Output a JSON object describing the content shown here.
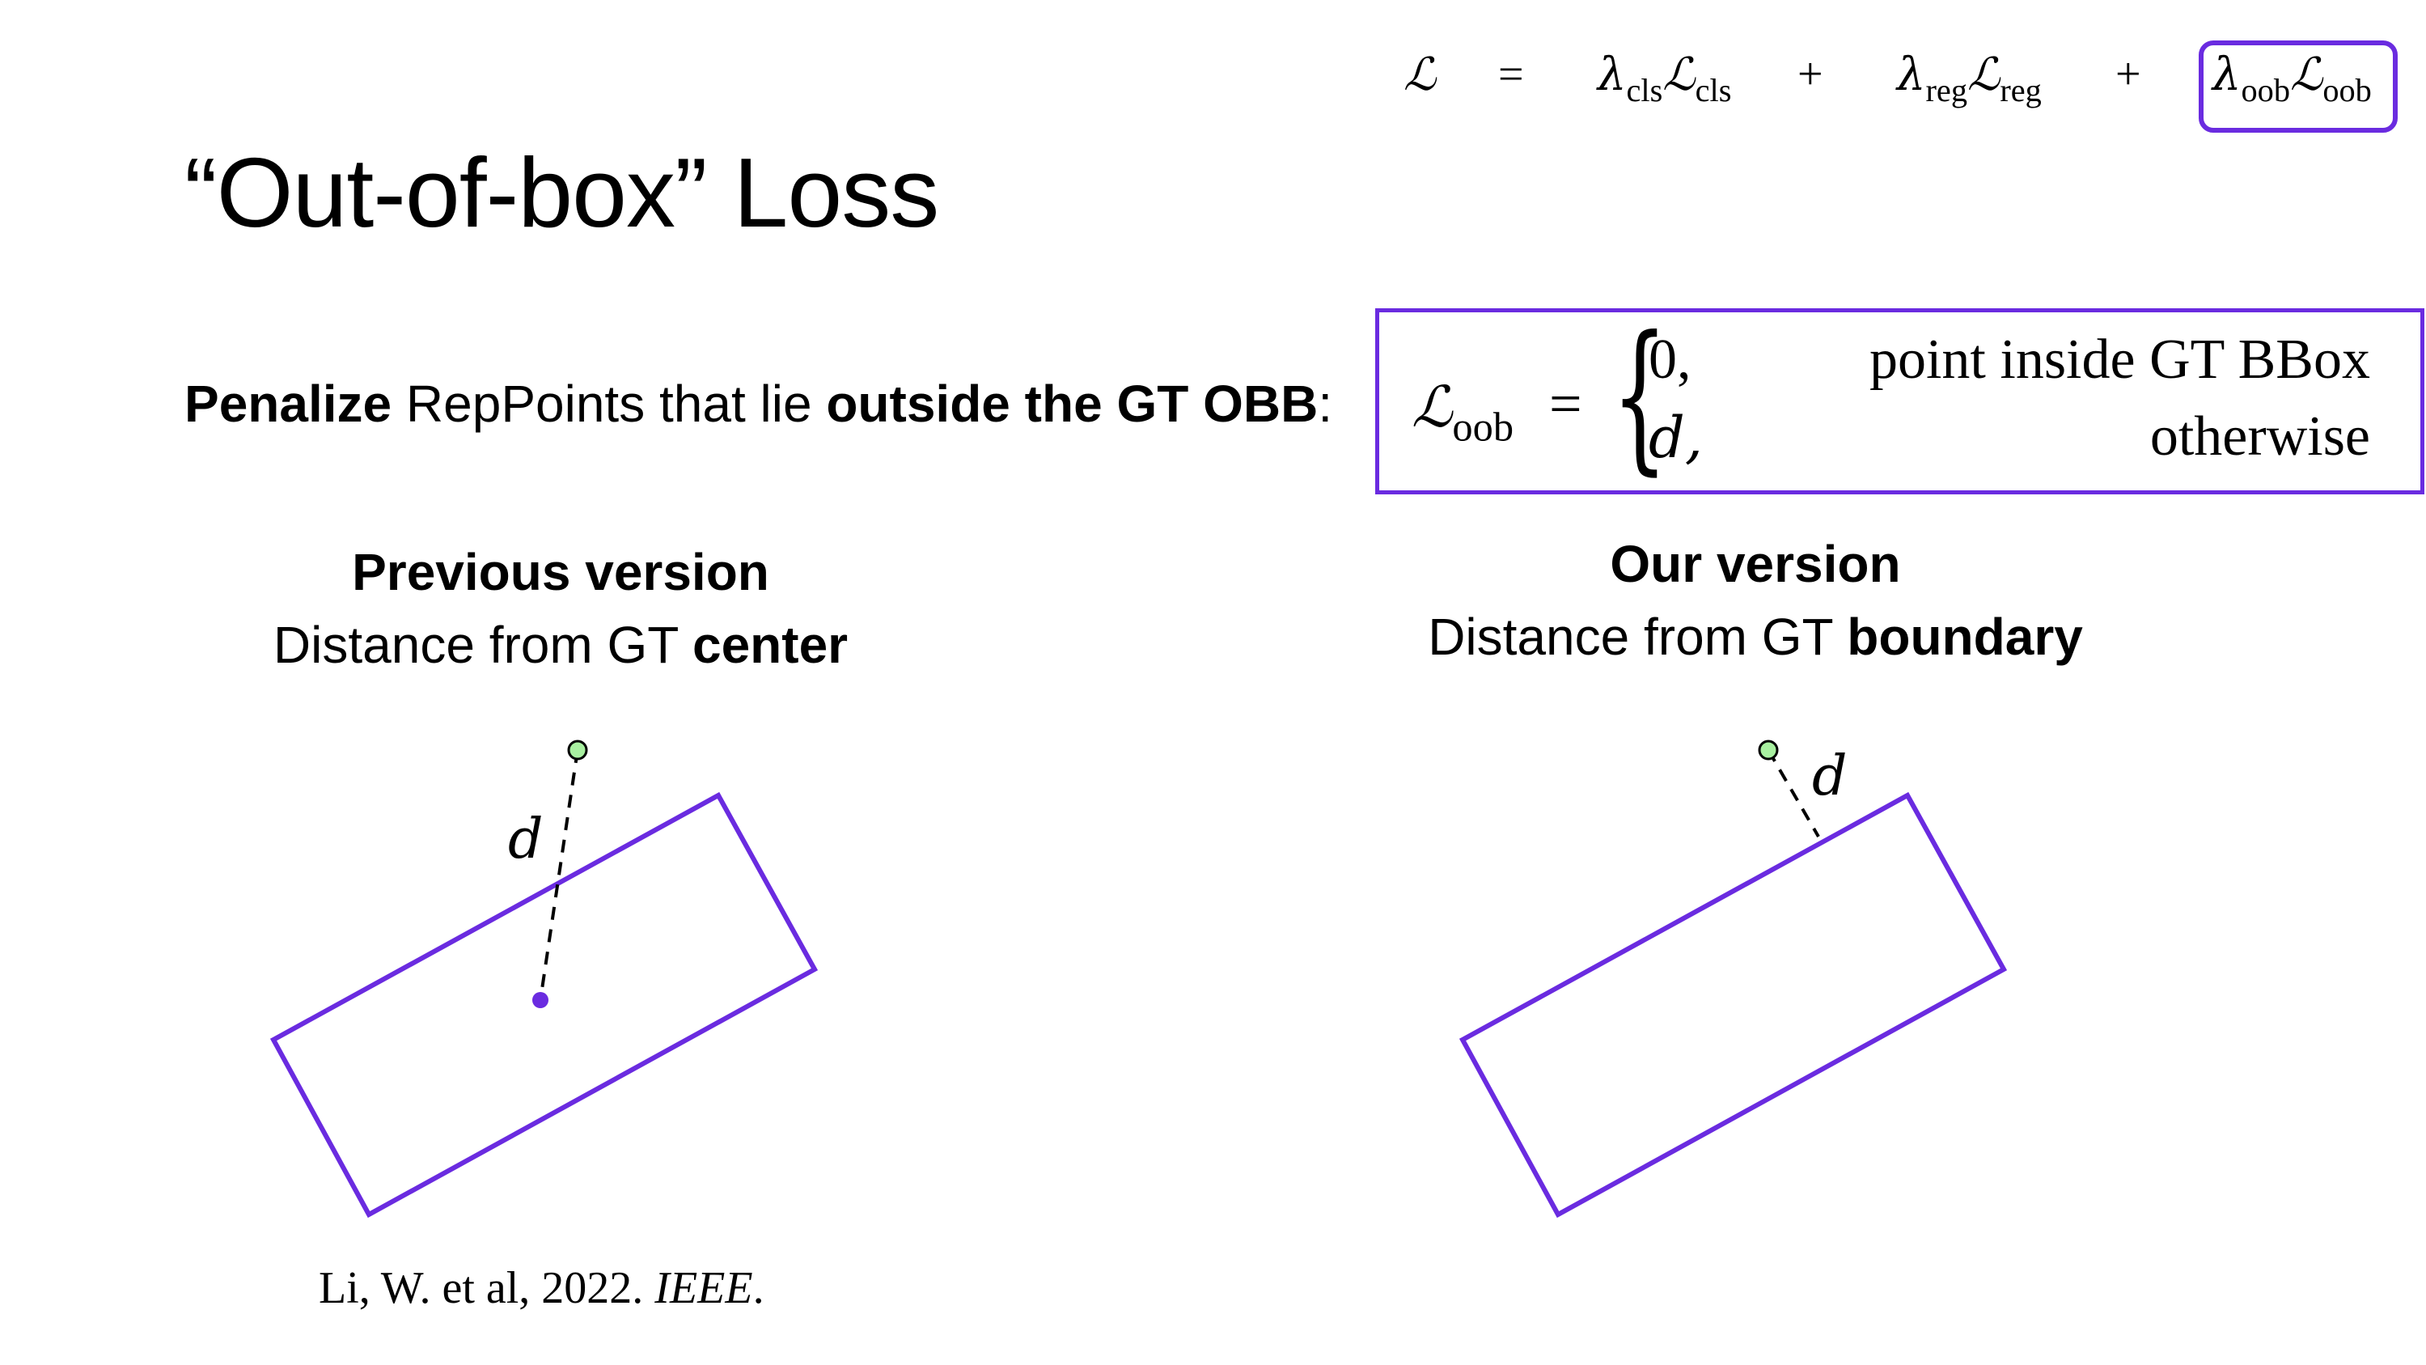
{
  "title": "“Out-of-box” Loss",
  "total_loss_equation": {
    "lhs": "ℒ",
    "eq": "=",
    "term1_lambda": "λ",
    "term1_sub": "cls",
    "term1_L": "ℒ",
    "term1_L_sub": "cls",
    "plus1": "+",
    "term2_lambda": "λ",
    "term2_sub": "reg",
    "term2_L": "ℒ",
    "term2_L_sub": "reg",
    "plus2": "+",
    "term3_lambda": "λ",
    "term3_sub": "oob",
    "term3_L": "ℒ",
    "term3_L_sub": "oob"
  },
  "penalize_line": {
    "bold1": "Penalize",
    "plain1": " RepPoints that lie ",
    "bold2": "outside the GT OBB",
    "plain2": ":"
  },
  "loob_definition": {
    "lhs": "ℒ",
    "lhs_sub": "oob",
    "eq": "=",
    "case1_value": "0,",
    "case1_condition": "point inside GT BBox",
    "case2_value": "d,",
    "case2_condition": "otherwise"
  },
  "previous": {
    "heading": "Previous version",
    "desc_plain": "Distance from GT ",
    "desc_bold": "center",
    "d_label": "d"
  },
  "ours": {
    "heading": "Our version",
    "desc_plain": "Distance from GT ",
    "desc_bold": "boundary",
    "d_label": "d"
  },
  "citation": {
    "plain": "Li, W. et al, 2022. ",
    "italic": "IEEE",
    "end": "."
  },
  "colors": {
    "box": "#6a2be0",
    "point_fill": "#a8f0a0",
    "center_dot": "#6a2be0"
  }
}
